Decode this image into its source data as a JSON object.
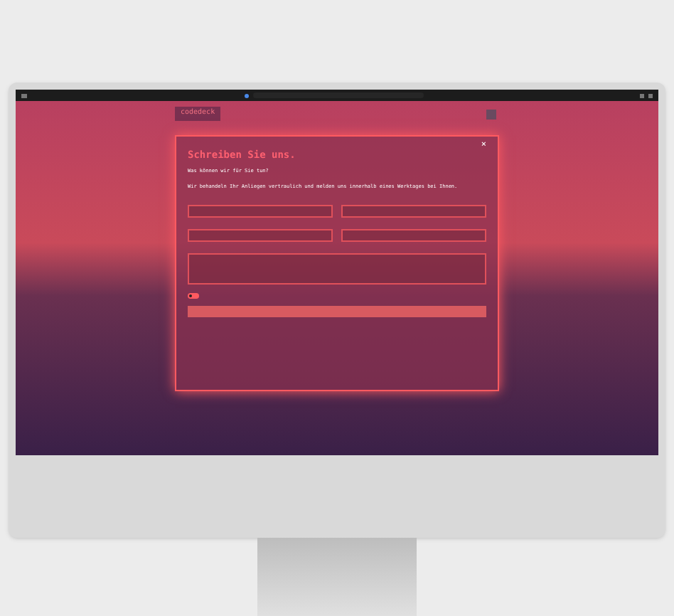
{
  "header": {
    "logo": "codedeck"
  },
  "dialog": {
    "close": "×",
    "title": "Schreiben Sie uns.",
    "subtitle": "Was können wir für Sie tun?",
    "intro": "Wir behandeln Ihr Anliegen vertraulich und melden uns innerhalb eines Werktages bei Ihnen.",
    "fields": [
      {
        "kind": "input"
      },
      {
        "kind": "input"
      },
      {
        "kind": "input"
      },
      {
        "kind": "input"
      },
      {
        "kind": "textarea"
      }
    ],
    "consent": {
      "on": false
    }
  }
}
